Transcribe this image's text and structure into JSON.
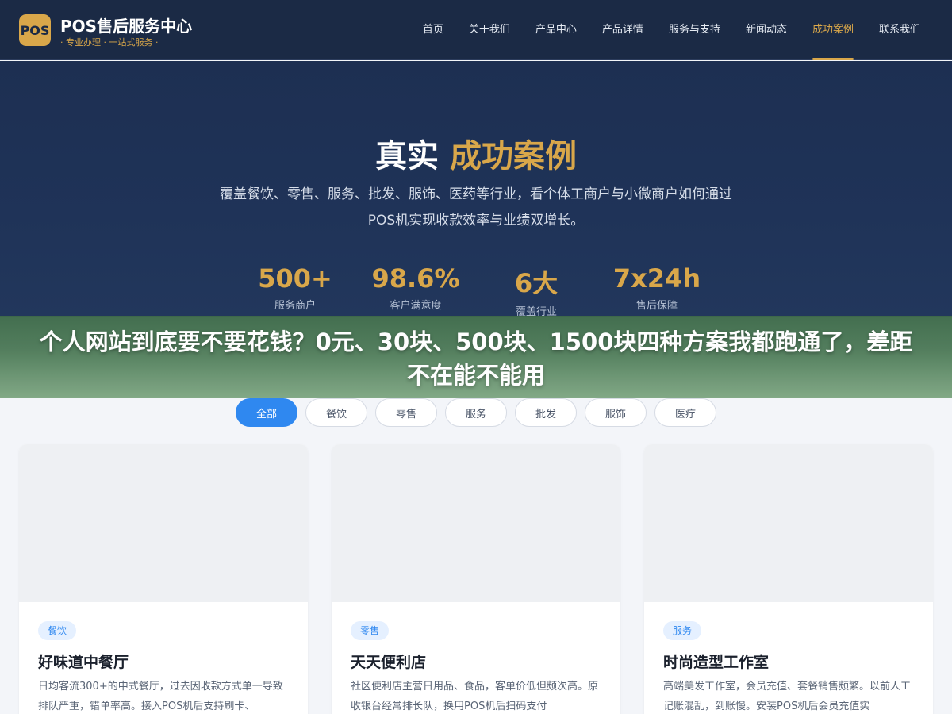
{
  "header": {
    "logo_text": "POS",
    "brand_title": "POS售后服务中心",
    "brand_sub": "· 专业办理 · 一站式服务 ·",
    "nav": [
      {
        "label": "首页"
      },
      {
        "label": "关于我们"
      },
      {
        "label": "产品中心"
      },
      {
        "label": "产品详情"
      },
      {
        "label": "服务与支持"
      },
      {
        "label": "新闻动态"
      },
      {
        "label": "成功案例",
        "active": true
      },
      {
        "label": "联系我们"
      }
    ]
  },
  "hero": {
    "title_white": "真实",
    "title_gold": "成功案例",
    "desc": "覆盖餐饮、零售、服务、批发、服饰、医药等行业，看个体工商户与小微商户如何通过POS机实现收款效率与业绩双增长。",
    "stats": [
      {
        "num": "500+",
        "label": "服务商户"
      },
      {
        "num": "98.6%",
        "label": "客户满意度"
      },
      {
        "num": "6大",
        "label": "覆盖行业"
      },
      {
        "num": "7x24h",
        "label": "售后保障"
      }
    ]
  },
  "banner": {
    "text": "个人网站到底要不要花钱？0元、30块、500块、1500块四种方案我都跑通了，差距不在能不能用"
  },
  "filters": [
    {
      "label": "全部",
      "active": true
    },
    {
      "label": "餐饮"
    },
    {
      "label": "零售"
    },
    {
      "label": "服务"
    },
    {
      "label": "批发"
    },
    {
      "label": "服饰"
    },
    {
      "label": "医疗"
    }
  ],
  "cards": [
    {
      "tag": "餐饮",
      "title": "好味道中餐厅",
      "desc": "日均客流300+的中式餐厅，过去因收款方式单一导致排队严重，错单率高。接入POS机后支持刷卡、"
    },
    {
      "tag": "零售",
      "title": "天天便利店",
      "desc": "社区便利店主营日用品、食品，客单价低但频次高。原收银台经常排长队，换用POS机后扫码支付"
    },
    {
      "tag": "服务",
      "title": "时尚造型工作室",
      "desc": "高端美发工作室，会员充值、套餐销售频繁。以前人工记账混乱，到账慢。安装POS机后会员充值实"
    }
  ],
  "colors": {
    "accent": "#d9a74a",
    "primary": "#2f88f0",
    "header_bg": "#1b2a45"
  }
}
